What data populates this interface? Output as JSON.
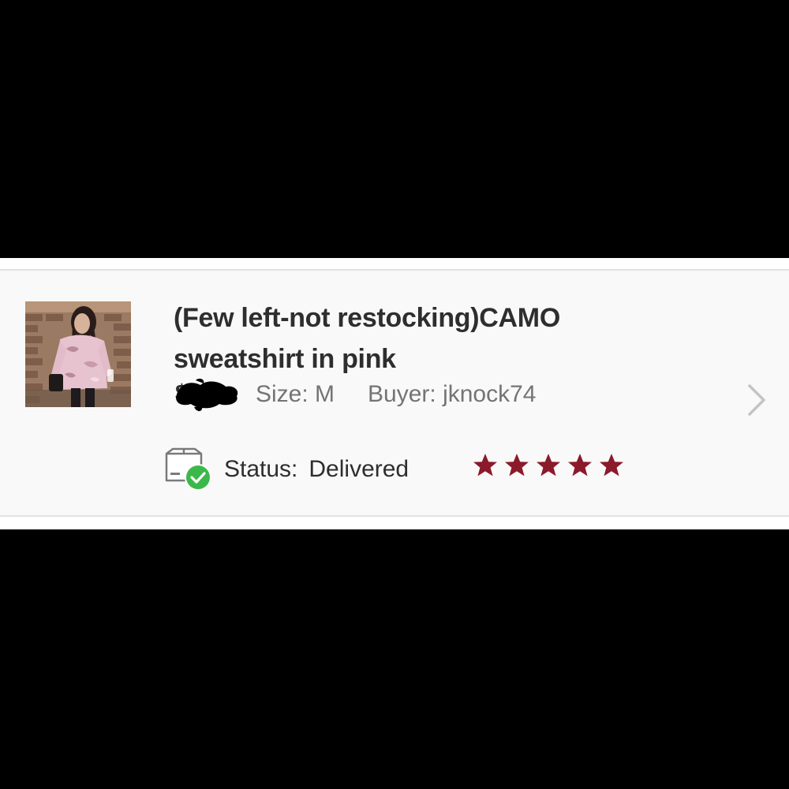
{
  "item": {
    "title_line1": "(Few left-not restocking)CAMO",
    "title_line2": "sweatshirt in pink",
    "price": "$25",
    "size_label": "Size: M",
    "buyer_label": "Buyer: jknock74"
  },
  "status": {
    "label": "Status:",
    "value": "Delivered"
  },
  "rating": {
    "stars": 5,
    "max": 5
  },
  "colors": {
    "star": "#8b1a2b",
    "check_badge": "#3cb84a",
    "title_text": "#2e2e2e",
    "secondary_text": "#747474"
  },
  "icons": {
    "thumbnail": "product-photo",
    "status": "package-delivered-icon",
    "chevron": "chevron-right-icon",
    "star": "star-icon"
  }
}
